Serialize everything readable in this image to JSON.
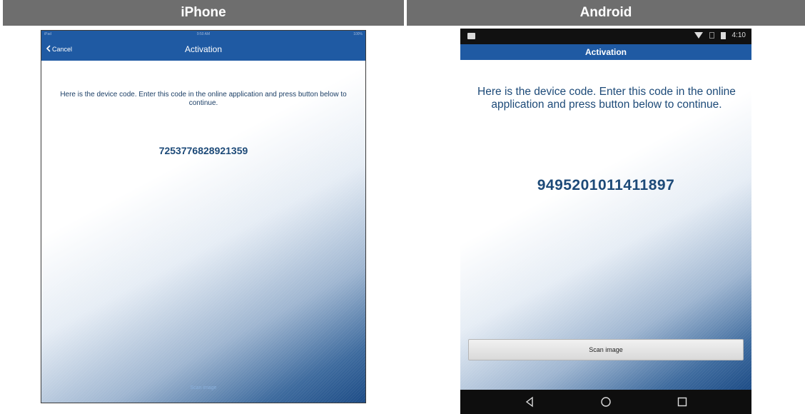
{
  "headers": {
    "iphone": "iPhone",
    "android": "Android"
  },
  "iphone": {
    "status": {
      "left": "iPad",
      "center": "9:50 AM",
      "right": "100%"
    },
    "nav": {
      "back_label": "Cancel",
      "title": "Activation"
    },
    "instructions": "Here is the device code. Enter this code in the online application and press button below to continue.",
    "device_code": "7253776828921359",
    "scan_label": "Scan image"
  },
  "android": {
    "status": {
      "time": "4:10"
    },
    "appbar_title": "Activation",
    "instructions": "Here is the device code. Enter this code in the online application and press button below to continue.",
    "device_code": "9495201011411897",
    "scan_button_label": "Scan image",
    "nav_icons": [
      "back-icon",
      "home-icon",
      "recents-icon"
    ]
  },
  "colors": {
    "brand_blue": "#1f5aa3",
    "code_blue": "#1d4a78",
    "header_gray": "#6e6e6e"
  }
}
